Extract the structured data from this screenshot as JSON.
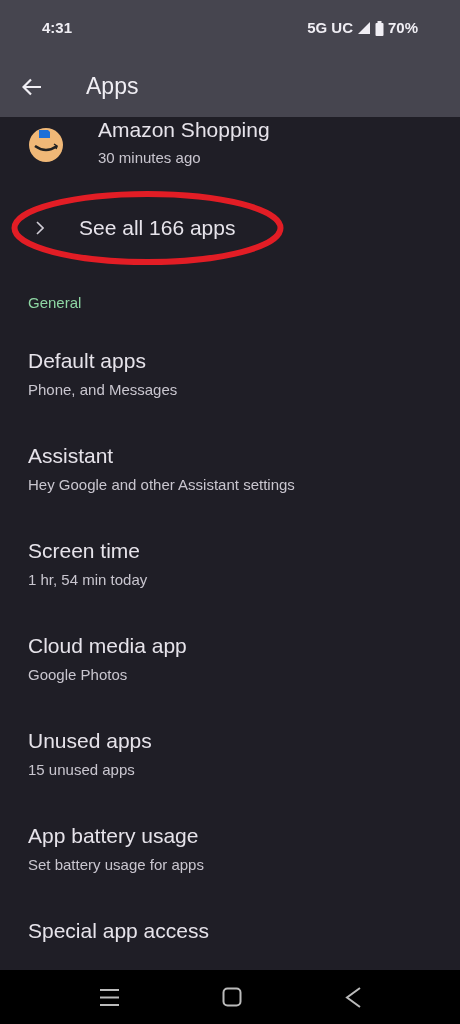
{
  "status_bar": {
    "time": "4:31",
    "network": "5G UC",
    "battery": "70%"
  },
  "app_bar": {
    "title": "Apps"
  },
  "recent_app": {
    "name": "Amazon Shopping",
    "time": "30 minutes ago"
  },
  "see_all": {
    "label": "See all 166 apps",
    "circled": true
  },
  "section_header": "General",
  "items": [
    {
      "title": "Default apps",
      "subtitle": "Phone, and Messages"
    },
    {
      "title": "Assistant",
      "subtitle": "Hey Google and other Assistant settings"
    },
    {
      "title": "Screen time",
      "subtitle": "1 hr, 54 min today"
    },
    {
      "title": "Cloud media app",
      "subtitle": "Google Photos"
    },
    {
      "title": "Unused apps",
      "subtitle": "15 unused apps"
    },
    {
      "title": "App battery usage",
      "subtitle": "Set battery usage for apps"
    },
    {
      "title": "Special app access"
    }
  ]
}
